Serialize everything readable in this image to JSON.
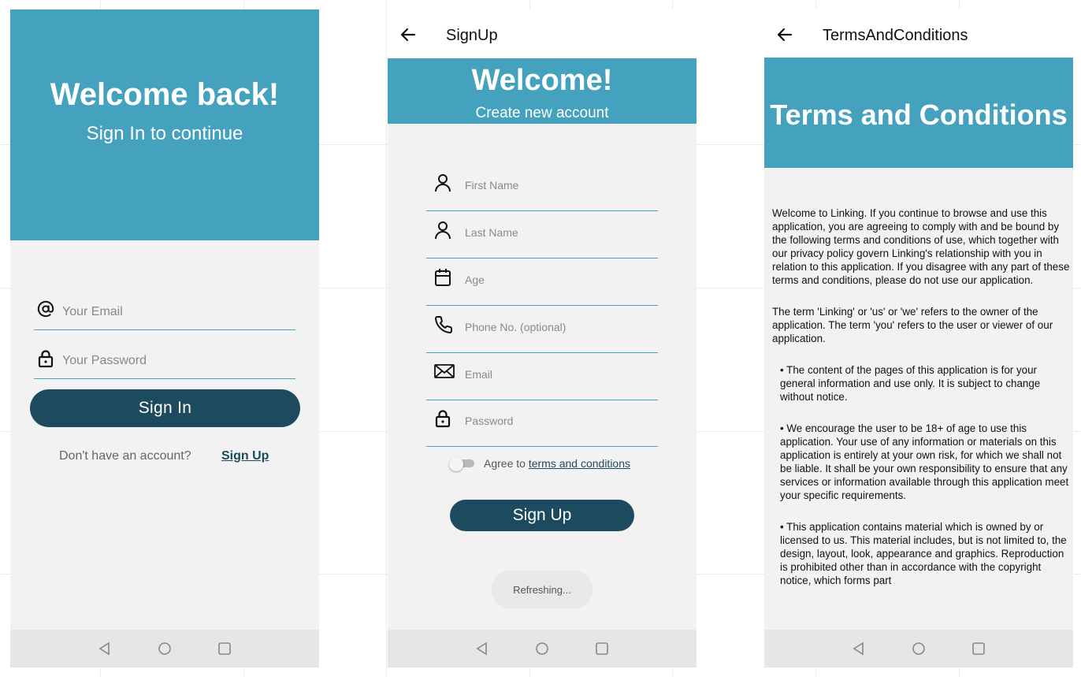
{
  "signin": {
    "title": "Welcome back!",
    "subtitle": "Sign In to continue",
    "email_placeholder": "Your Email",
    "password_placeholder": "Your Password",
    "signin_button": "Sign In",
    "no_account_text": "Don't have an account?",
    "signup_link": "Sign Up"
  },
  "signup": {
    "topbar_title": "SignUp",
    "title": "Welcome!",
    "subtitle": "Create new account",
    "fields": [
      {
        "placeholder": "First Name",
        "icon": "person-icon"
      },
      {
        "placeholder": "Last Name",
        "icon": "person-icon"
      },
      {
        "placeholder": "Age",
        "icon": "calendar-icon"
      },
      {
        "placeholder": "Phone No. (optional)",
        "icon": "phone-icon"
      },
      {
        "placeholder": "Email",
        "icon": "mail-icon"
      },
      {
        "placeholder": "Password",
        "icon": "lock-icon"
      }
    ],
    "agree_prefix": "Agree to",
    "terms_link": "terms and conditions",
    "terms_toggle_on": false,
    "signup_button": "Sign Up",
    "toast": "Refreshing..."
  },
  "terms": {
    "topbar_title": "TermsAndConditions",
    "title": "Terms and Conditions",
    "paragraphs": [
      "Welcome to Linking. If you continue to browse and use this application, you are agreeing to comply with and be bound by the following terms and conditions of use, which together with our privacy policy govern Linking's relationship with you in relation to this application. If you disagree with any part of these terms and conditions, please do not use our application.",
      "The term 'Linking' or 'us' or 'we' refers to the owner of the application. The term 'you' refers to the user or viewer of our application.",
      "• The content of the pages of this application is for your general information and use only. It is subject to change without notice.",
      "• We encourage the user to be 18+ of age to use this application. Your use of any information or materials on this application is entirely at your own risk, for which we shall not be liable. It shall be your own responsibility to ensure that any services or information available through this application meet your specific requirements.",
      "• This application contains material which is owned by or licensed to us. This material includes, but is not limited to, the design, layout, look, appearance and graphics. Reproduction is prohibited other than in accordance with the copyright notice, which forms part"
    ]
  },
  "colors": {
    "header_teal": "#44a2be",
    "button_navy": "#1d4a5e",
    "screen_bg": "#f2f2f2"
  }
}
